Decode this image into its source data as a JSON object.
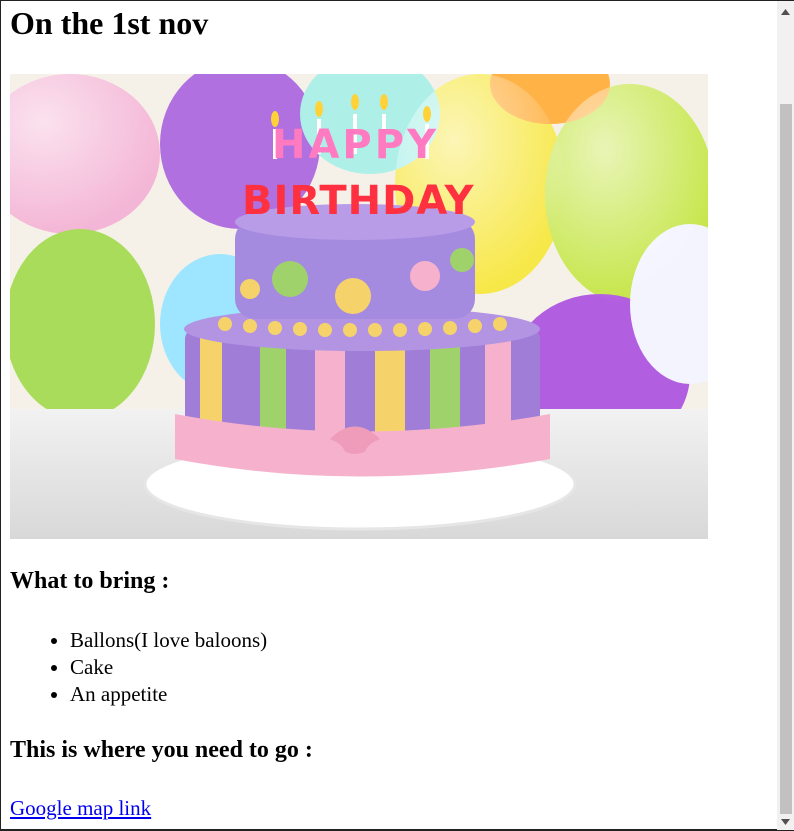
{
  "heading": "On the 1st nov",
  "image": {
    "cake_text_top": "HAPPY",
    "cake_text_bottom": "BIRTHDAY"
  },
  "bring_heading": "What to bring :",
  "bring_items": [
    "Ballons(I love baloons)",
    "Cake",
    "An appetite"
  ],
  "go_heading": "This is where you need to go :",
  "map_link": "Google map link"
}
